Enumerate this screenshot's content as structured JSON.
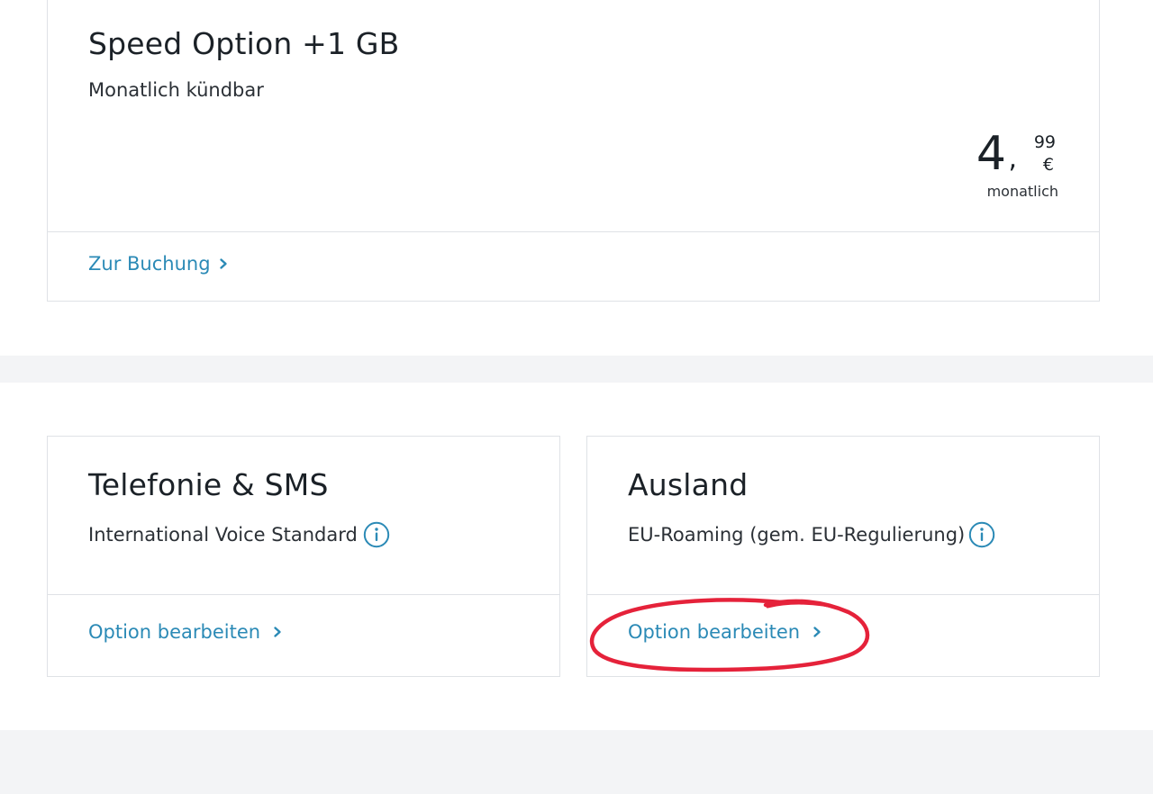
{
  "speed_card": {
    "title": "Speed Option +1 GB",
    "subtitle": "Monatlich kündbar",
    "price": {
      "integer": "4",
      "separator": ",",
      "cents": "99",
      "currency": "€",
      "period": "monatlich"
    },
    "link_label": "Zur Buchung"
  },
  "telefonie_card": {
    "title": "Telefonie & SMS",
    "subtitle": "International Voice Standard",
    "link_label": "Option bearbeiten"
  },
  "ausland_card": {
    "title": "Ausland",
    "subtitle": "EU-Roaming (gem. EU-Regulierung)",
    "link_label": "Option bearbeiten"
  },
  "icons": {
    "info": "info-circle-icon",
    "chevron": "chevron-right-icon"
  },
  "colors": {
    "link": "#2b8ab6",
    "text": "#1b2127",
    "border": "#dfe2e6",
    "band": "#f3f4f6",
    "annotation": "#e5223a"
  }
}
